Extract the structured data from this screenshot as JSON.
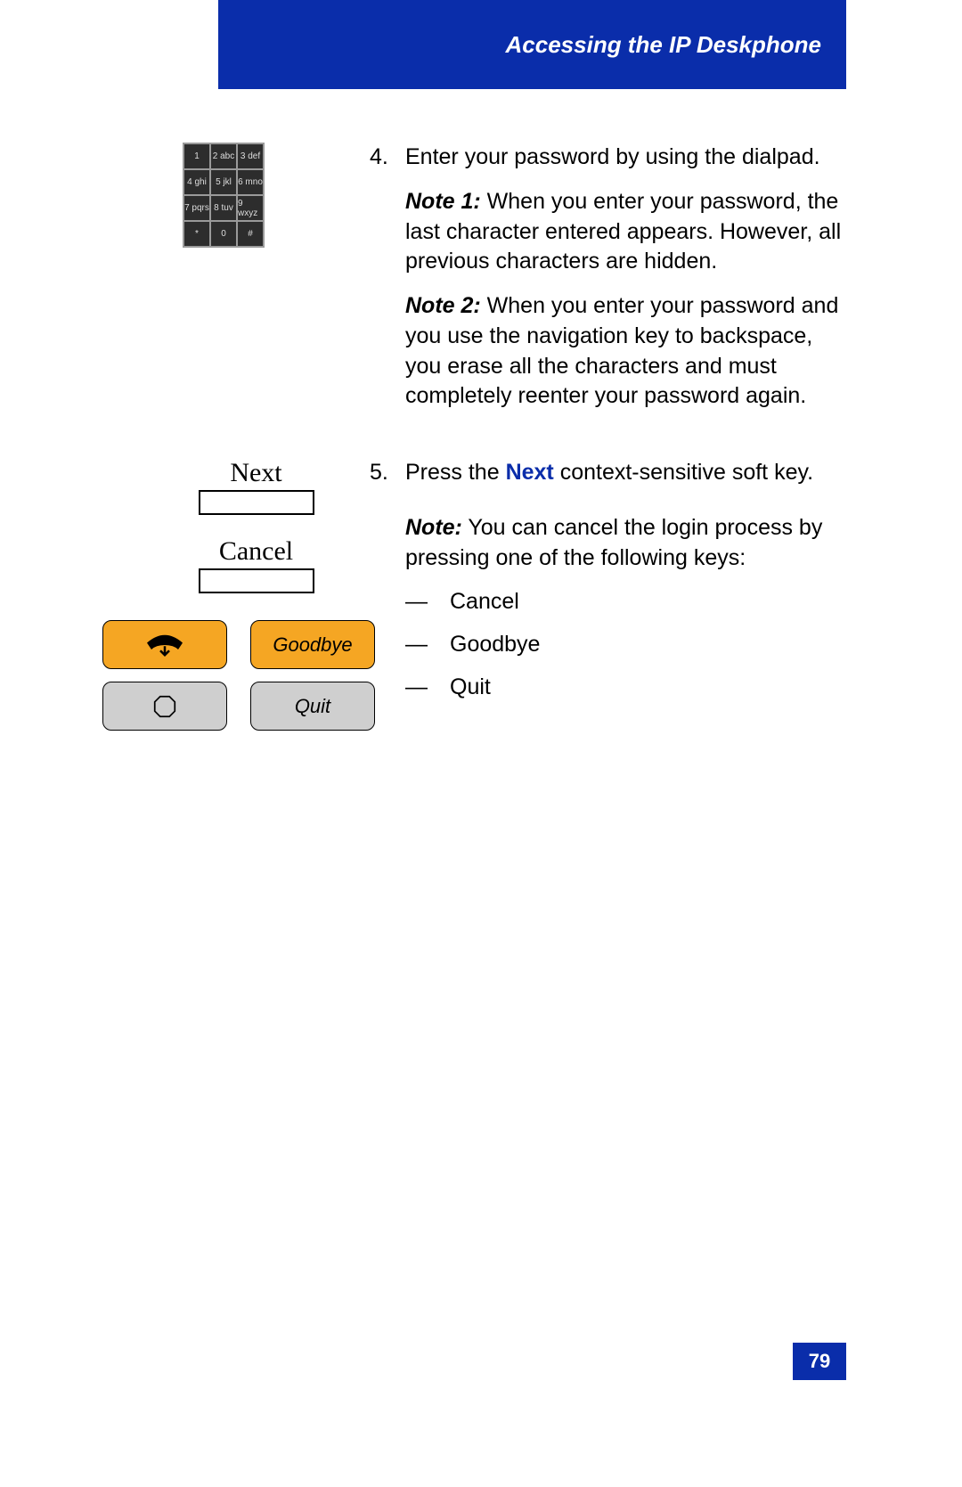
{
  "header": {
    "title": "Accessing the IP Deskphone"
  },
  "dialpad": {
    "keys": [
      "1",
      "2 abc",
      "3 def",
      "4 ghi",
      "5 jkl",
      "6 mno",
      "7 pqrs",
      "8 tuv",
      "9 wxyz",
      "*",
      "0",
      "#"
    ]
  },
  "step4": {
    "num": "4.",
    "text": "Enter your password by using the dialpad.",
    "note1_label": "Note 1:",
    "note1_text": " When you enter your password, the last character entered appears. However, all previous characters are hidden.",
    "note2_label": "Note 2:",
    "note2_text": " When you enter your password and you use the navigation key to backspace, you erase all the characters and must completely reenter your password again."
  },
  "softkeys": {
    "next": "Next",
    "cancel": "Cancel"
  },
  "hw_buttons": {
    "goodbye": "Goodbye",
    "quit": "Quit"
  },
  "step5": {
    "num": "5.",
    "text_before": "Press the ",
    "next_word": "Next",
    "text_after": " context-sensitive soft key.",
    "note_label": "Note:",
    "note_text": " You can cancel the login process by pressing one of the following keys:",
    "items": [
      "Cancel",
      "Goodbye",
      "Quit"
    ]
  },
  "dash": "—",
  "page_number": "79"
}
